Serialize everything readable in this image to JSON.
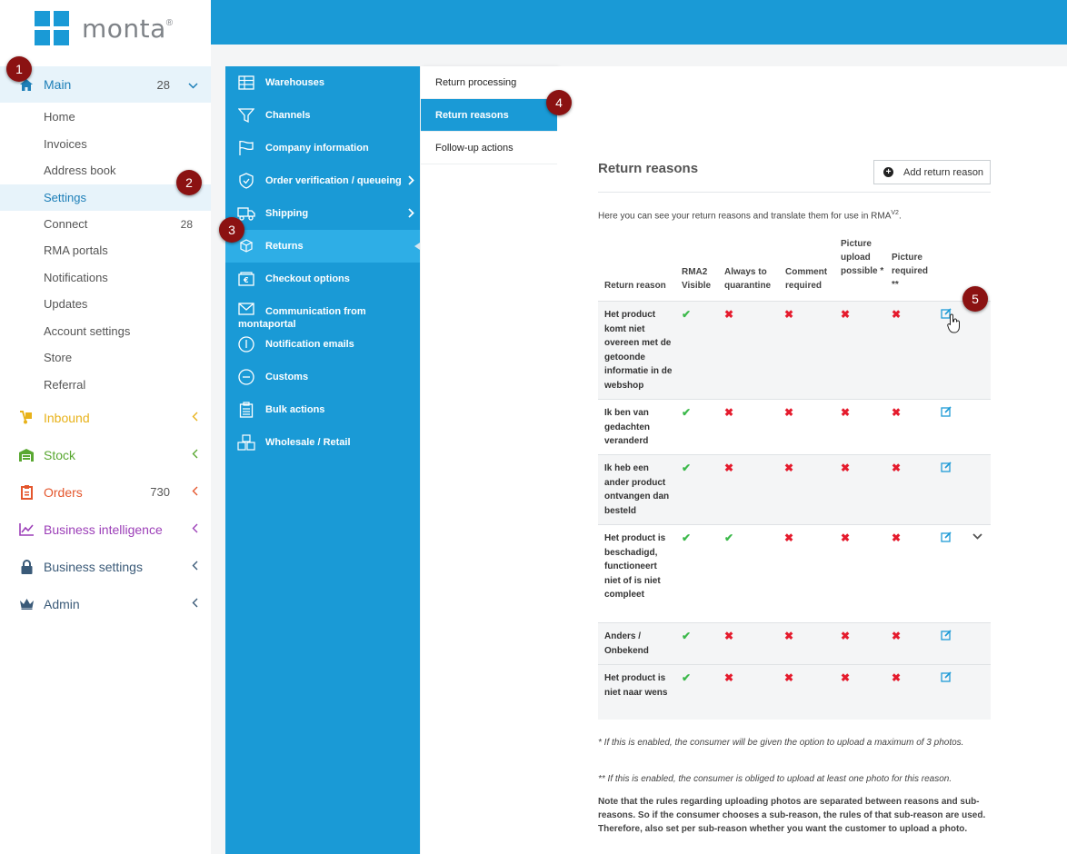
{
  "logo": {
    "text": "monta",
    "reg": "®"
  },
  "sidebar": {
    "main": {
      "label": "Main",
      "count": "28",
      "color": "#1d7fb8"
    },
    "sub_items": [
      {
        "label": "Home",
        "count": ""
      },
      {
        "label": "Invoices",
        "count": ""
      },
      {
        "label": "Address book",
        "count": ""
      },
      {
        "label": "Settings",
        "count": ""
      },
      {
        "label": "Connect",
        "count": "28"
      },
      {
        "label": "RMA portals",
        "count": ""
      },
      {
        "label": "Notifications",
        "count": ""
      },
      {
        "label": "Updates",
        "count": ""
      },
      {
        "label": "Account settings",
        "count": ""
      },
      {
        "label": "Store",
        "count": ""
      },
      {
        "label": "Referral",
        "count": ""
      }
    ],
    "groups": [
      {
        "label": "Inbound",
        "count": "",
        "color": "#e8b21a",
        "icon": "dolly-icon"
      },
      {
        "label": "Stock",
        "count": "",
        "color": "#5aa832",
        "icon": "warehouse-icon"
      },
      {
        "label": "Orders",
        "count": "730",
        "color": "#e4572e",
        "icon": "clipboard-icon"
      },
      {
        "label": "Business intelligence",
        "count": "",
        "color": "#9c3fb8",
        "icon": "chart-line-icon"
      },
      {
        "label": "Business settings",
        "count": "",
        "color": "#3a5a78",
        "icon": "lock-icon"
      },
      {
        "label": "Admin",
        "count": "",
        "color": "#3a5a78",
        "icon": "crown-icon"
      }
    ]
  },
  "settings_menu": [
    {
      "label": "Warehouses",
      "icon": "warehouse-shelves-icon",
      "arrow": ""
    },
    {
      "label": "Channels",
      "icon": "funnel-icon",
      "arrow": ""
    },
    {
      "label": "Company information",
      "icon": "flag-icon",
      "arrow": ""
    },
    {
      "label": "Order verification / queueing",
      "icon": "shield-check-icon",
      "arrow": "›"
    },
    {
      "label": "Shipping",
      "icon": "truck-icon",
      "arrow": "›"
    },
    {
      "label": "Returns",
      "icon": "box-return-icon",
      "arrow": ""
    },
    {
      "label": "Checkout options",
      "icon": "wallet-icon",
      "arrow": ""
    },
    {
      "label": "Communication from montaportal",
      "icon": "envelope-icon",
      "arrow": ""
    },
    {
      "label": "Notification emails",
      "icon": "info-circle-icon",
      "arrow": ""
    },
    {
      "label": "Customs",
      "icon": "minus-circle-icon",
      "arrow": ""
    },
    {
      "label": "Bulk actions",
      "icon": "clipboard-list-icon",
      "arrow": ""
    },
    {
      "label": "Wholesale / Retail",
      "icon": "boxes-icon",
      "arrow": ""
    }
  ],
  "returns_menu": [
    "Return processing",
    "Return reasons",
    "Follow-up actions"
  ],
  "content": {
    "title": "Return reasons",
    "add_button": "Add return reason",
    "intro": "Here you can see your return reasons and translate them for use in RMA",
    "intro_sup": "V2",
    "intro_end": ".",
    "headers": {
      "reason": "Return reason",
      "rma2": "RMA2 Visible",
      "quarantine": "Always to quarantine",
      "comment": "Comment required",
      "upload": "Picture upload possible *",
      "required": "Picture required **"
    },
    "rows": [
      {
        "reason": "Het product komt niet overeen met de getoonde informatie in de webshop",
        "rma2": "✔",
        "quarantine": "✖",
        "comment": "✖",
        "upload": "✖",
        "required": "✖"
      },
      {
        "reason": "Ik ben van gedachten veranderd",
        "rma2": "✔",
        "quarantine": "✖",
        "comment": "✖",
        "upload": "✖",
        "required": "✖"
      },
      {
        "reason": "Ik heb een ander product ontvangen dan besteld",
        "rma2": "✔",
        "quarantine": "✖",
        "comment": "✖",
        "upload": "✖",
        "required": "✖"
      },
      {
        "reason": "Het product is beschadigd, functioneert niet of is niet compleet",
        "rma2": "✔",
        "quarantine": "✔",
        "comment": "✖",
        "upload": "✖",
        "required": "✖"
      },
      {
        "reason": "Anders / Onbekend",
        "rma2": "✔",
        "quarantine": "✖",
        "comment": "✖",
        "upload": "✖",
        "required": "✖"
      },
      {
        "reason": "Het product is niet naar wens",
        "rma2": "✔",
        "quarantine": "✖",
        "comment": "✖",
        "upload": "✖",
        "required": "✖"
      }
    ],
    "note1": "* If this is enabled, the consumer will be given the option to upload a maximum of 3 photos.",
    "note2": "** If this is enabled, the consumer is obliged to upload at least one photo for this reason.",
    "note3": "Note that the rules regarding uploading photos are separated between reasons and sub-reasons. So if the consumer chooses a sub-reason, the rules of that sub-reason are used. Therefore, also set per sub-reason whether you want the customer to upload a photo."
  },
  "markers": [
    "1",
    "2",
    "3",
    "4",
    "5"
  ],
  "colors": {
    "brand_blue": "#1a9ad6",
    "marker": "#8b1212",
    "check": "#3cb94b",
    "cross": "#e51b2d"
  }
}
